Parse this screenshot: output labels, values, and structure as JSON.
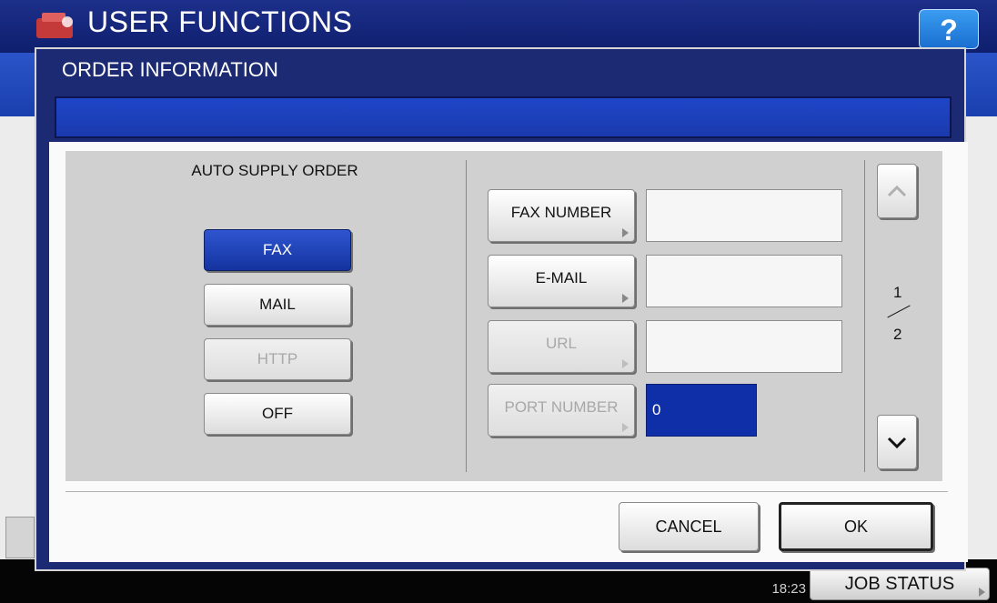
{
  "window": {
    "title": "USER FUNCTIONS",
    "help_label": "?",
    "datetime_time": "18:23",
    "job_status_label": "JOB STATUS"
  },
  "dialog": {
    "title": "ORDER INFORMATION",
    "auto_supply": {
      "label": "AUTO SUPPLY ORDER",
      "options": [
        {
          "label": "FAX",
          "state": "selected"
        },
        {
          "label": "MAIL",
          "state": "enabled"
        },
        {
          "label": "HTTP",
          "state": "disabled"
        },
        {
          "label": "OFF",
          "state": "enabled"
        }
      ]
    },
    "fields": [
      {
        "label": "FAX NUMBER",
        "value": "",
        "enabled": true
      },
      {
        "label": "E-MAIL",
        "value": "",
        "enabled": true
      },
      {
        "label": "URL",
        "value": "",
        "enabled": false
      },
      {
        "label": "PORT NUMBER",
        "value": "0",
        "enabled": false
      }
    ],
    "pagination": {
      "current": "1",
      "total": "2"
    },
    "cancel_label": "CANCEL",
    "ok_label": "OK"
  },
  "colors": {
    "selected": "#14339f",
    "title_bar": "#1c2a73",
    "panel": "#d0d0d0"
  }
}
